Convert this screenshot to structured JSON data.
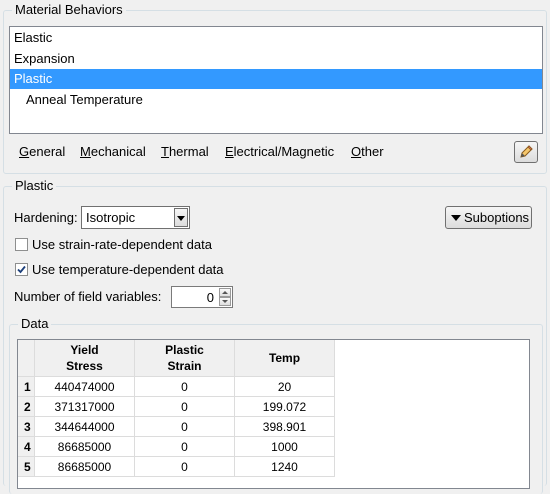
{
  "material_behaviors": {
    "title": "Material Behaviors",
    "items": [
      {
        "label": "Elastic"
      },
      {
        "label": "Expansion"
      },
      {
        "label": "Plastic"
      },
      {
        "label": "Anneal Temperature"
      }
    ],
    "selected": "Plastic",
    "menus": [
      {
        "label": "General",
        "mnemonic": "G"
      },
      {
        "label": "Mechanical",
        "mnemonic": "M"
      },
      {
        "label": "Thermal",
        "mnemonic": "T"
      },
      {
        "label": "Electrical/Magnetic",
        "mnemonic": "E"
      },
      {
        "label": "Other",
        "mnemonic": "O"
      }
    ],
    "edit_icon": "pencil-icon"
  },
  "plastic": {
    "title": "Plastic",
    "hardening_label": "Hardening:",
    "hardening_value": "Isotropic",
    "suboptions_label": "Suboptions",
    "strain_rate_label": "Use strain-rate-dependent data",
    "strain_rate_checked": false,
    "temperature_label": "Use temperature-dependent data",
    "temperature_checked": true,
    "field_vars_label": "Number of field variables:",
    "field_vars_value": "0"
  },
  "data": {
    "title": "Data",
    "columns": [
      {
        "line1": "Yield",
        "line2": "Stress"
      },
      {
        "line1": "Plastic",
        "line2": "Strain"
      },
      {
        "line1": "Temp",
        "line2": ""
      }
    ],
    "rows": [
      {
        "index": "1",
        "yield_stress": "440474000",
        "plastic_strain": "0",
        "temp": "20"
      },
      {
        "index": "2",
        "yield_stress": "371317000",
        "plastic_strain": "0",
        "temp": "199.072"
      },
      {
        "index": "3",
        "yield_stress": "344644000",
        "plastic_strain": "0",
        "temp": "398.901"
      },
      {
        "index": "4",
        "yield_stress": "86685000",
        "plastic_strain": "0",
        "temp": "1000"
      },
      {
        "index": "5",
        "yield_stress": "86685000",
        "plastic_strain": "0",
        "temp": "1240"
      }
    ]
  }
}
